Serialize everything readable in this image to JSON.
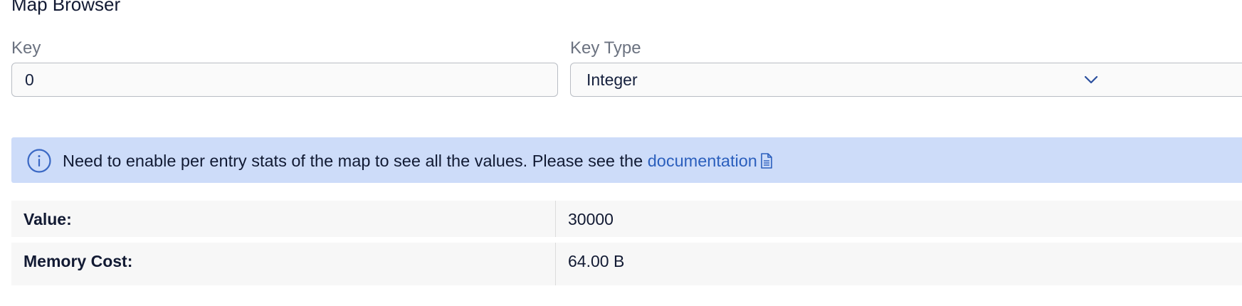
{
  "page": {
    "title": "Map Browser"
  },
  "form": {
    "key_label": "Key",
    "key_value": "0",
    "key_type_label": "Key Type",
    "key_type_selected": "Integer"
  },
  "banner": {
    "message": "Need to enable per entry stats of the map to see all the values. Please see the ",
    "link_text": "documentation",
    "icons": [
      "info-icon",
      "document-icon"
    ],
    "background_color": "#cddcf9",
    "link_color": "#2b5fbd"
  },
  "details": {
    "rows": [
      {
        "label": "Value:",
        "value": "30000"
      },
      {
        "label": "Memory Cost:",
        "value": "64.00 B"
      }
    ]
  }
}
